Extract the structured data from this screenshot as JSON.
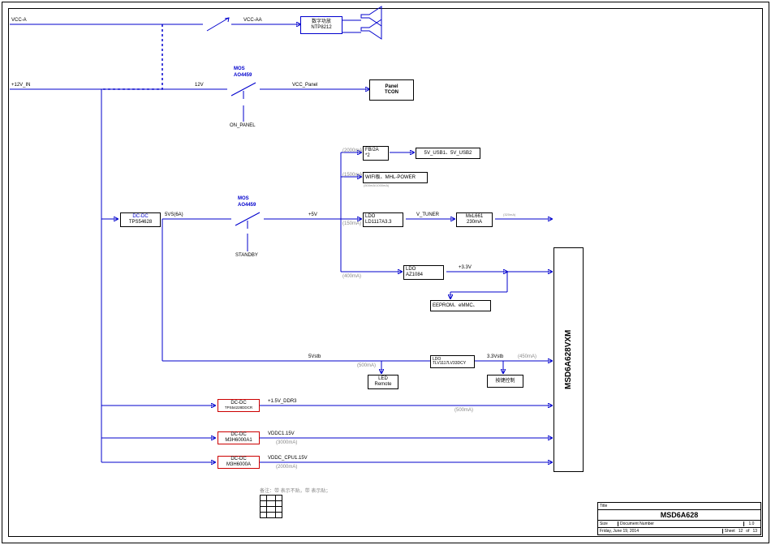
{
  "inputs": {
    "vcc_a": "VCC-A",
    "v12": "+12V_IN"
  },
  "nets": {
    "vcc_aa": "VCC-AA",
    "v12": "12V",
    "vcc_panel": "VCC_Panel",
    "svs": "5VS(6A)",
    "p5v": "+5V",
    "p5vstb": "5Vstb",
    "p33vstb": "3.3Vstb",
    "ddr": "+1.5V_DDR3",
    "vddc1": "VDDC1.15V",
    "vddc_cpu": "VDDC_CPU1.15V",
    "p33v": "+3.3V",
    "vtuner": "V_TUNER",
    "on_panel": "ON_PANEL",
    "standby": "STANDBY"
  },
  "currents": {
    "usb": "(2000mA)",
    "wifi": "(1500mA)",
    "tuner": "(150mA)",
    "p33": "(400mA)",
    "stb": "(500mA)",
    "p33stb": "(450mA)",
    "ddr": "(500mA)",
    "vddc1": "(3000mA)",
    "vddc_cpu": "(2000mA)",
    "mxl": "(320mA)",
    "wifidetail": "(500mA/1000mA)"
  },
  "blocks": {
    "amp": {
      "l1": "数字功放",
      "l2": "NTP8212"
    },
    "panel": {
      "l1": "Panel",
      "l2": "TCON"
    },
    "mos1": {
      "l1": "MOS",
      "l2": "AO4459"
    },
    "mos2": {
      "l1": "MOS",
      "l2": "AO4459"
    },
    "dcdc1": {
      "l1": "DC-DC",
      "l2": "TPS54628"
    },
    "dcdc2": {
      "l1": "DC-DC",
      "l2": "TPS54228DDCR"
    },
    "dcdc3": {
      "l1": "DC-DC",
      "l2": "M3H6000A1"
    },
    "dcdc4": {
      "l1": "DC-DC",
      "l2": "M3H6000A"
    },
    "fb": {
      "l1": "FB/2A",
      "l2": "*2"
    },
    "usb": "5V_USB1、5V_USB2",
    "wifi": "WIFI板、MHL-POWER",
    "ldo1": {
      "l1": "LDO",
      "l2": "LD1117A3.3"
    },
    "ldo2": {
      "l1": "LDO",
      "l2": "AZ1084"
    },
    "ldo3": {
      "l1": "LDO",
      "l2": "TLV1117LV33DCY"
    },
    "mxl": {
      "l1": "MxL661",
      "l2": "230mA"
    },
    "eeprom": "EEPROM、eMMC、",
    "led": {
      "l1": "LED",
      "l2": "Remote"
    },
    "key": "按键控制",
    "chip": "MSD6A628VXM"
  },
  "note": "备注：带 表示不贴，带 表示贴；",
  "title": {
    "name": "MSD6A628",
    "rev": "1.0",
    "date": "Friday, June 19, 2014",
    "sheet_l": "Sheet",
    "sheet_a": "12",
    "of": "of",
    "sheet_b": "13",
    "size": "Size",
    "docnum": "Document Number",
    "titlelbl": "Title"
  }
}
